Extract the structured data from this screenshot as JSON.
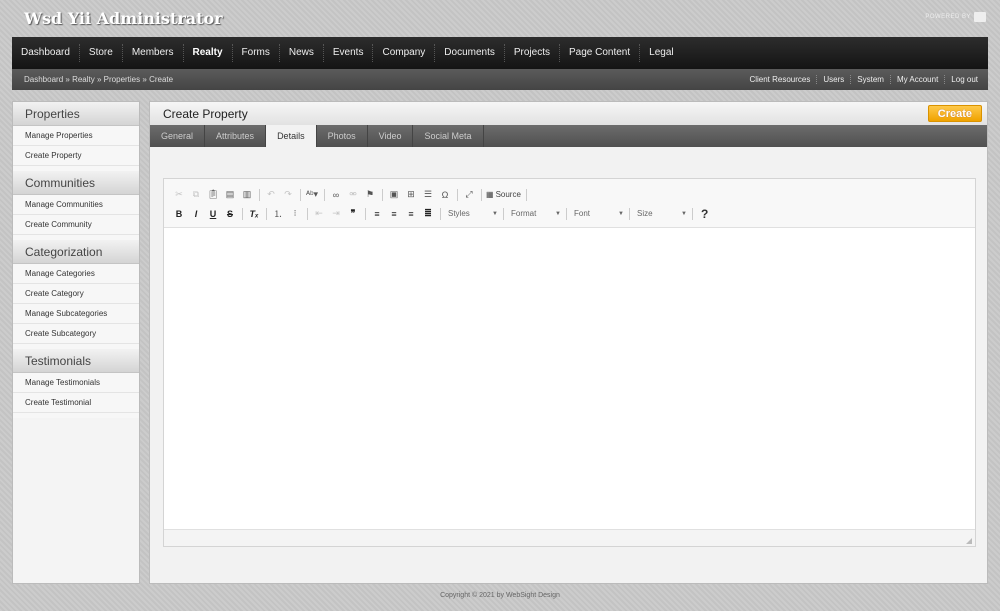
{
  "header": {
    "title": "Wsd Yii Administrator",
    "powered_by": "POWERED BY"
  },
  "mainnav": [
    "Dashboard",
    "Store",
    "Members",
    "Realty",
    "Forms",
    "News",
    "Events",
    "Company",
    "Documents",
    "Projects",
    "Page Content",
    "Legal"
  ],
  "active_nav": "Realty",
  "breadcrumb": {
    "items": [
      "Dashboard",
      "Realty",
      "Properties",
      "Create"
    ],
    "separator": "»"
  },
  "topright": [
    "Client Resources",
    "Users",
    "System",
    "My Account",
    "Log out"
  ],
  "sidebar": {
    "groups": [
      {
        "title": "Properties",
        "links": [
          "Manage Properties",
          "Create Property"
        ]
      },
      {
        "title": "Communities",
        "links": [
          "Manage Communities",
          "Create Community"
        ]
      },
      {
        "title": "Categorization",
        "links": [
          "Manage Categories",
          "Create Category",
          "Manage Subcategories",
          "Create Subcategory"
        ]
      },
      {
        "title": "Testimonials",
        "links": [
          "Manage Testimonials",
          "Create Testimonial"
        ]
      }
    ]
  },
  "content": {
    "title": "Create Property",
    "create_label": "Create",
    "tabs": [
      "General",
      "Attributes",
      "Details",
      "Photos",
      "Video",
      "Social Meta"
    ],
    "active_tab": "Details"
  },
  "editor": {
    "source_label": "Source",
    "combos": [
      "Styles",
      "Format",
      "Font",
      "Size"
    ],
    "help": "?",
    "content": ""
  },
  "footer": {
    "copyright": "Copyright © 2021 by WebSight Design"
  }
}
